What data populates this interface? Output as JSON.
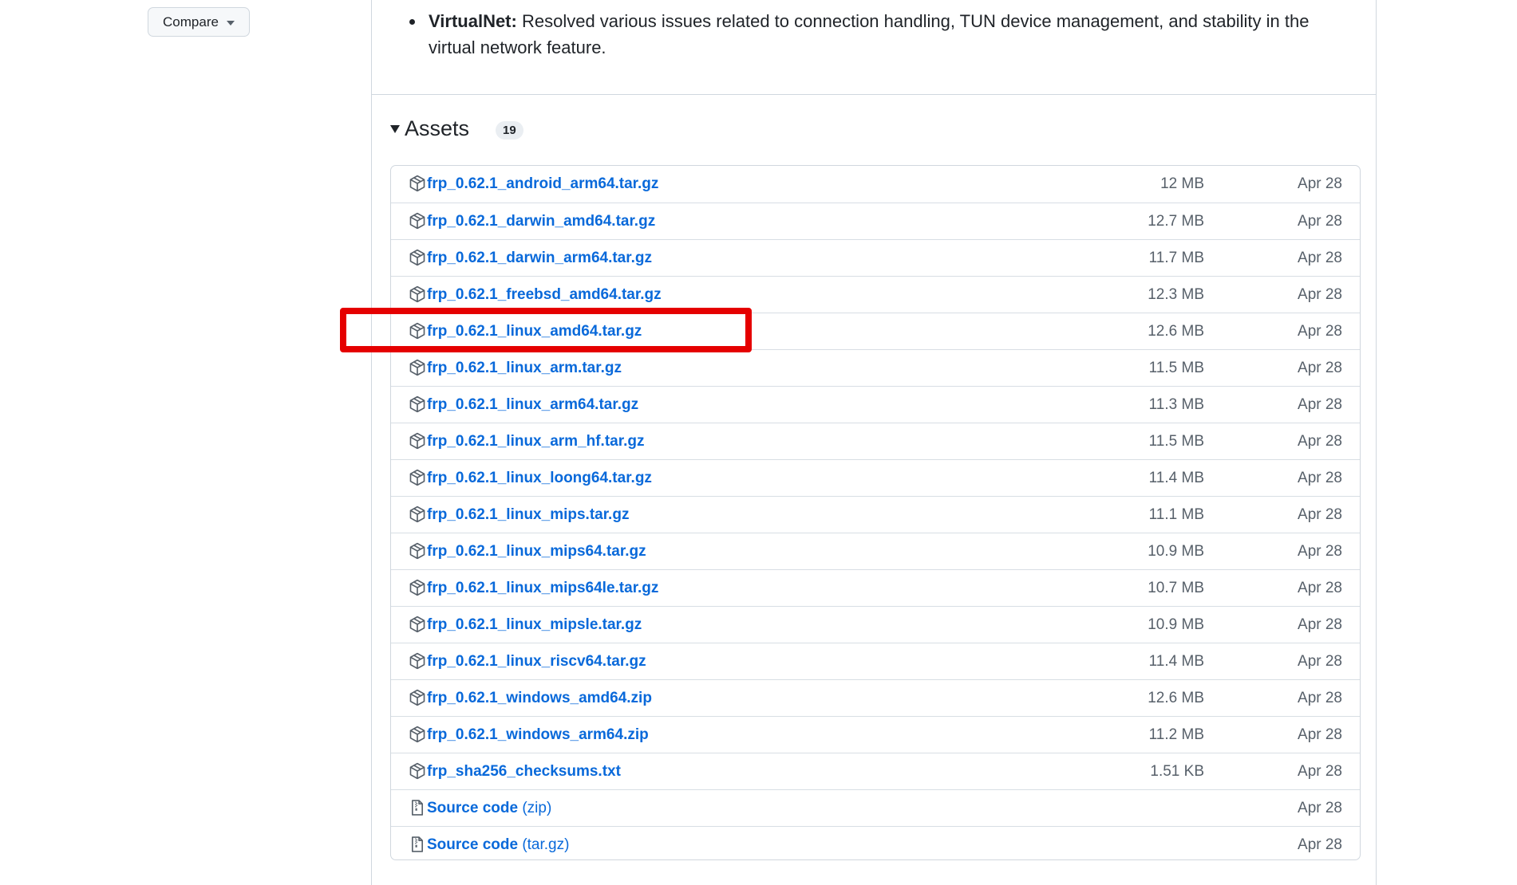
{
  "toolbar": {
    "compare_label": "Compare"
  },
  "notes": {
    "item_title": "VirtualNet:",
    "item_text": " Resolved various issues related to connection handling, TUN device management, and stability in the virtual network feature."
  },
  "assets": {
    "title": "Assets",
    "count": "19",
    "rows": [
      {
        "name": "frp_0.62.1_android_arm64.tar.gz",
        "size": "12 MB",
        "date": "Apr 28",
        "icon": "package-icon"
      },
      {
        "name": "frp_0.62.1_darwin_amd64.tar.gz",
        "size": "12.7 MB",
        "date": "Apr 28",
        "icon": "package-icon"
      },
      {
        "name": "frp_0.62.1_darwin_arm64.tar.gz",
        "size": "11.7 MB",
        "date": "Apr 28",
        "icon": "package-icon"
      },
      {
        "name": "frp_0.62.1_freebsd_amd64.tar.gz",
        "size": "12.3 MB",
        "date": "Apr 28",
        "icon": "package-icon"
      },
      {
        "name": "frp_0.62.1_linux_amd64.tar.gz",
        "size": "12.6 MB",
        "date": "Apr 28",
        "icon": "package-icon"
      },
      {
        "name": "frp_0.62.1_linux_arm.tar.gz",
        "size": "11.5 MB",
        "date": "Apr 28",
        "icon": "package-icon"
      },
      {
        "name": "frp_0.62.1_linux_arm64.tar.gz",
        "size": "11.3 MB",
        "date": "Apr 28",
        "icon": "package-icon"
      },
      {
        "name": "frp_0.62.1_linux_arm_hf.tar.gz",
        "size": "11.5 MB",
        "date": "Apr 28",
        "icon": "package-icon"
      },
      {
        "name": "frp_0.62.1_linux_loong64.tar.gz",
        "size": "11.4 MB",
        "date": "Apr 28",
        "icon": "package-icon"
      },
      {
        "name": "frp_0.62.1_linux_mips.tar.gz",
        "size": "11.1 MB",
        "date": "Apr 28",
        "icon": "package-icon"
      },
      {
        "name": "frp_0.62.1_linux_mips64.tar.gz",
        "size": "10.9 MB",
        "date": "Apr 28",
        "icon": "package-icon"
      },
      {
        "name": "frp_0.62.1_linux_mips64le.tar.gz",
        "size": "10.7 MB",
        "date": "Apr 28",
        "icon": "package-icon"
      },
      {
        "name": "frp_0.62.1_linux_mipsle.tar.gz",
        "size": "10.9 MB",
        "date": "Apr 28",
        "icon": "package-icon"
      },
      {
        "name": "frp_0.62.1_linux_riscv64.tar.gz",
        "size": "11.4 MB",
        "date": "Apr 28",
        "icon": "package-icon"
      },
      {
        "name": "frp_0.62.1_windows_amd64.zip",
        "size": "12.6 MB",
        "date": "Apr 28",
        "icon": "package-icon"
      },
      {
        "name": "frp_0.62.1_windows_arm64.zip",
        "size": "11.2 MB",
        "date": "Apr 28",
        "icon": "package-icon"
      },
      {
        "name": "frp_sha256_checksums.txt",
        "size": "1.51 KB",
        "date": "Apr 28",
        "icon": "package-icon"
      },
      {
        "name": "Source code",
        "suffix": " (zip)",
        "size": "",
        "date": "Apr 28",
        "icon": "file-zip-icon"
      },
      {
        "name": "Source code",
        "suffix": " (tar.gz)",
        "size": "",
        "date": "Apr 28",
        "icon": "file-zip-icon"
      }
    ]
  },
  "colors": {
    "link": "#0969da",
    "muted": "#57606a",
    "highlight": "#e50000"
  }
}
